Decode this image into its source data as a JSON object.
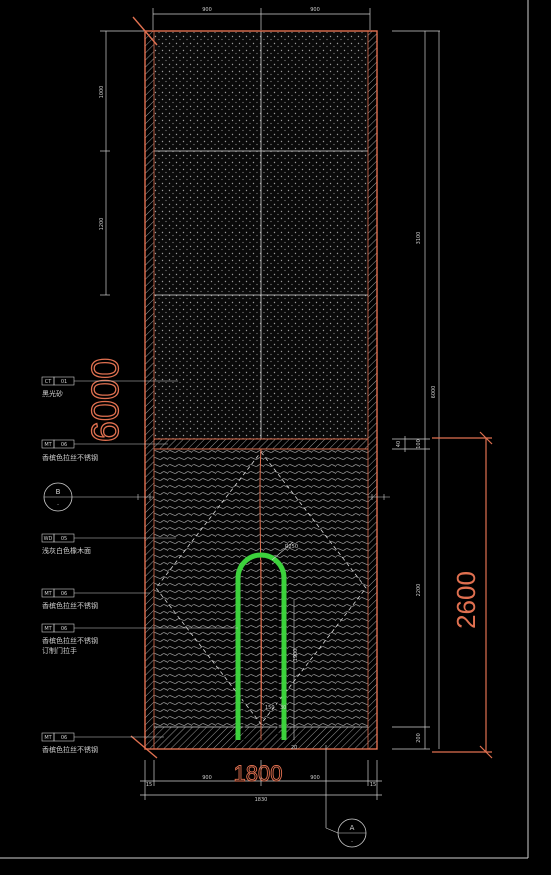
{
  "dimensions": {
    "top_left": "900",
    "top_right": "900",
    "left_1": "1000",
    "left_2": "1200",
    "right_total": "3100",
    "right_outer": "6000",
    "right_small_a": "40",
    "right_small_b": "100",
    "right_mid": "2200",
    "right_bottom": "200",
    "arch_radius": "R250",
    "handle_len": "1900",
    "handle_w": "150",
    "handle_w2": "30",
    "bottom_gap": "20",
    "bottom_left_end": "15",
    "bottom_right_end": "15",
    "bottom_mid_left": "900",
    "bottom_mid_right": "900",
    "bottom_total": "1830"
  },
  "annotations": {
    "height_handwritten": "6000",
    "width_handwritten": "1800",
    "height_2600": "2600"
  },
  "tags": [
    {
      "code": "CT",
      "num": "01",
      "desc": "黑光砂"
    },
    {
      "code": "MT",
      "num": "06",
      "desc": "香槟色拉丝不锈钢"
    },
    {
      "code": "WD",
      "num": "05",
      "desc": "浅灰白色橡木面"
    },
    {
      "code": "MT",
      "num": "06",
      "desc": "香槟色拉丝不锈钢"
    },
    {
      "code": "MT",
      "num": "06",
      "desc": "香槟色拉丝不锈钢"
    },
    {
      "code": "MT",
      "num": "06",
      "desc": "香槟色拉丝不锈钢"
    }
  ],
  "tag_extra": "订制门拉手",
  "section_markers": {
    "b_letter": "B",
    "b_sub": "-",
    "a_letter": "A",
    "a_sub": "-"
  },
  "colors": {
    "frame": "#e07050",
    "handle": "#3cd23c",
    "lines": "#cfcfcf"
  }
}
